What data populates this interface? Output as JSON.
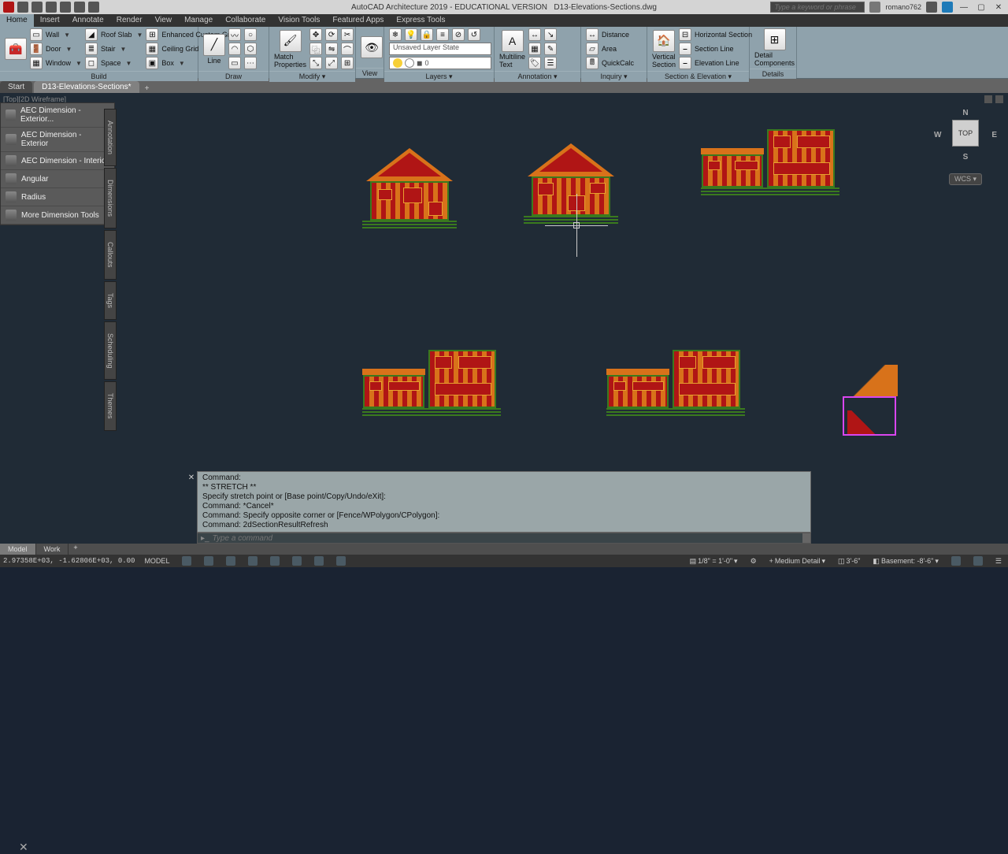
{
  "title": {
    "app": "AutoCAD Architecture 2019 - EDUCATIONAL VERSION",
    "file": "D13-Elevations-Sections.dwg"
  },
  "search_placeholder": "Type a keyword or phrase",
  "user": "romano762",
  "menu_tabs": [
    "Home",
    "Insert",
    "Annotate",
    "Render",
    "View",
    "Manage",
    "Collaborate",
    "Vision Tools",
    "Featured Apps",
    "Express Tools"
  ],
  "ribbon": {
    "build": {
      "title": "Build",
      "wall": "Wall",
      "door": "Door",
      "window": "Window",
      "roofslab": "Roof Slab",
      "stair": "Stair",
      "space": "Space",
      "grid": "Enhanced Custom Grid",
      "ceiling": "Ceiling Grid",
      "box": "Box"
    },
    "draw": {
      "title": "Draw",
      "line": "Line"
    },
    "modify": {
      "title": "Modify ▾",
      "match": "Match\nProperties"
    },
    "view": {
      "title": "View"
    },
    "layers": {
      "title": "Layers ▾",
      "state": "Unsaved Layer State",
      "current": "0"
    },
    "annotation": {
      "title": "Annotation ▾",
      "mtext": "Multiline\nText"
    },
    "inquiry": {
      "title": "Inquiry ▾",
      "distance": "Distance",
      "area": "Area",
      "quickcalc": "QuickCalc"
    },
    "section": {
      "title": "Section & Elevation ▾",
      "vert": "Vertical\nSection",
      "hsec": "Horizontal Section",
      "sline": "Section Line",
      "eline": "Elevation Line"
    },
    "details": {
      "title": "Details",
      "comp": "Detail\nComponents"
    }
  },
  "doc_tabs": {
    "start": "Start",
    "active": "D13-Elevations-Sections*"
  },
  "viewport_label": "[Top][2D Wireframe]",
  "palette": {
    "items": [
      "AEC Dimension - Exterior...",
      "AEC Dimension - Exterior",
      "AEC Dimension - Interior",
      "Angular",
      "Radius",
      "More Dimension Tools"
    ],
    "tabs": [
      "Annotation",
      "Dimensions",
      "Callouts",
      "Tags",
      "Scheduling",
      "Themes"
    ]
  },
  "viewcube": {
    "top": "TOP",
    "n": "N",
    "s": "S",
    "e": "E",
    "w": "W",
    "wcs": "WCS ▾"
  },
  "cmd_history": [
    "Command:",
    "** STRETCH **",
    "Specify stretch point or [Base point/Copy/Undo/eXit]:",
    "Command: *Cancel*",
    "Command: Specify opposite corner or [Fence/WPolygon/CPolygon]:",
    "Command: 2dSectionResultRefresh"
  ],
  "cmd_placeholder": "Type a command",
  "layout_tabs": {
    "model": "Model",
    "work": "Work"
  },
  "status": {
    "coords": "2.97358E+03, -1.62806E+03, 0.00",
    "model": "MODEL",
    "scale": "1/8\" = 1'-0\"",
    "dim": "3'-6\"",
    "level": "Basement: -8'-6\"",
    "detail": "Medium Detail"
  }
}
